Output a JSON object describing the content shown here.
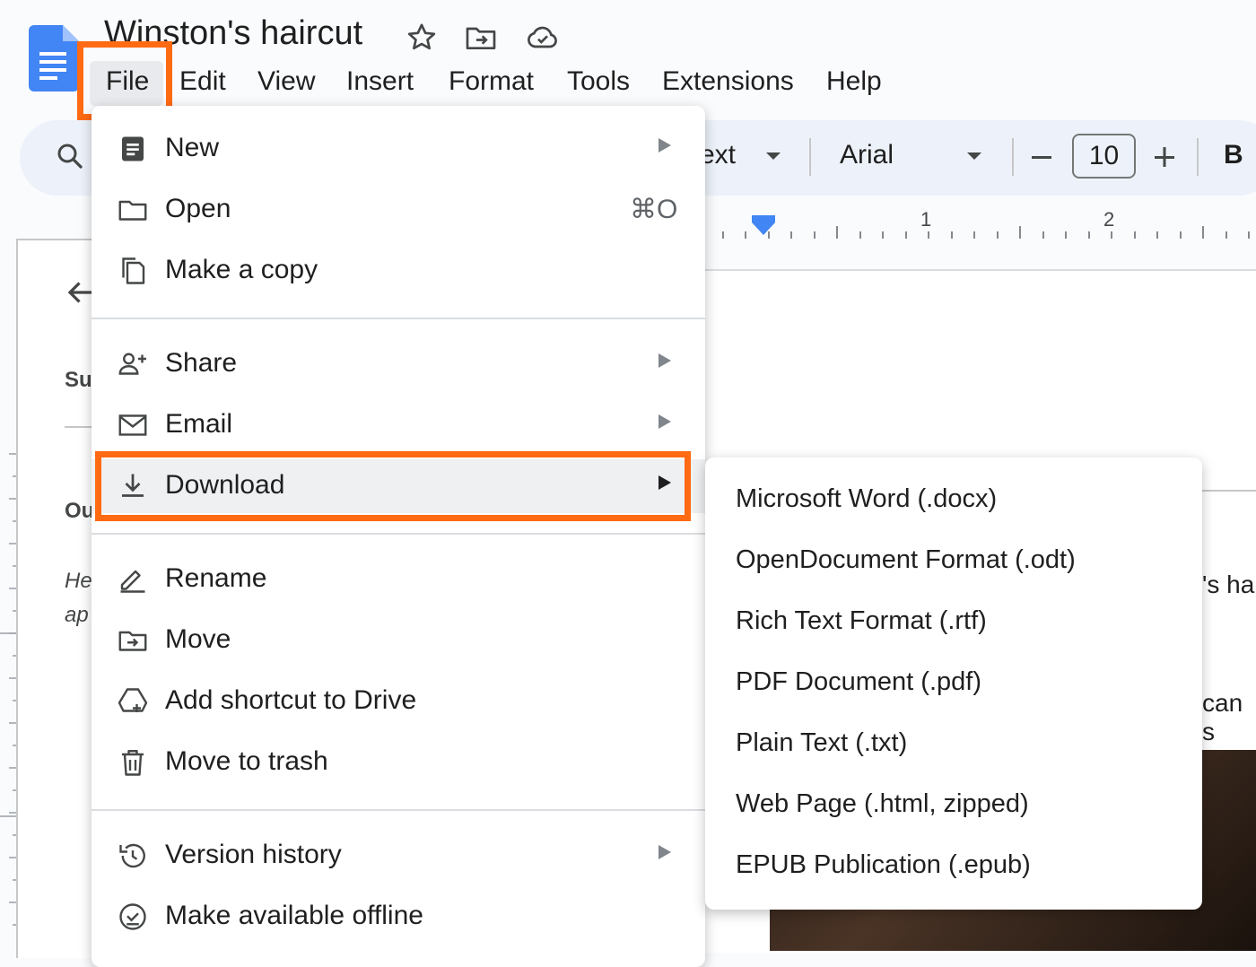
{
  "header": {
    "title": "Winston's haircut",
    "menu": [
      "File",
      "Edit",
      "View",
      "Insert",
      "Format",
      "Tools",
      "Extensions",
      "Help"
    ]
  },
  "toolbar": {
    "style_fragment": "ext",
    "font": "Arial",
    "font_size": "10",
    "bold": "B"
  },
  "ruler": {
    "labels": [
      "1",
      "2"
    ]
  },
  "left_panel": {
    "fragments": [
      "Su",
      "Ou",
      "He",
      "ap"
    ]
  },
  "page": {
    "fragments": [
      "'s ha",
      "can s"
    ]
  },
  "file_menu": {
    "new": "New",
    "open": "Open",
    "open_shortcut": "⌘O",
    "make_copy": "Make a copy",
    "share": "Share",
    "email": "Email",
    "download": "Download",
    "rename": "Rename",
    "move": "Move",
    "add_shortcut": "Add shortcut to Drive",
    "move_to_trash": "Move to trash",
    "version_history": "Version history",
    "make_offline": "Make available offline"
  },
  "download_menu": [
    "Microsoft Word (.docx)",
    "OpenDocument Format (.odt)",
    "Rich Text Format (.rtf)",
    "PDF Document (.pdf)",
    "Plain Text (.txt)",
    "Web Page (.html, zipped)",
    "EPUB Publication (.epub)"
  ],
  "colors": {
    "highlight": "#ff6a13",
    "docs_blue": "#4285f4",
    "toolbar_bg": "#edf2fa"
  },
  "icons": {
    "docs_logo": "docs-logo-icon",
    "star": "star-icon",
    "move_folder": "move-folder-icon",
    "cloud": "cloud-saved-icon",
    "search": "search-icon"
  }
}
